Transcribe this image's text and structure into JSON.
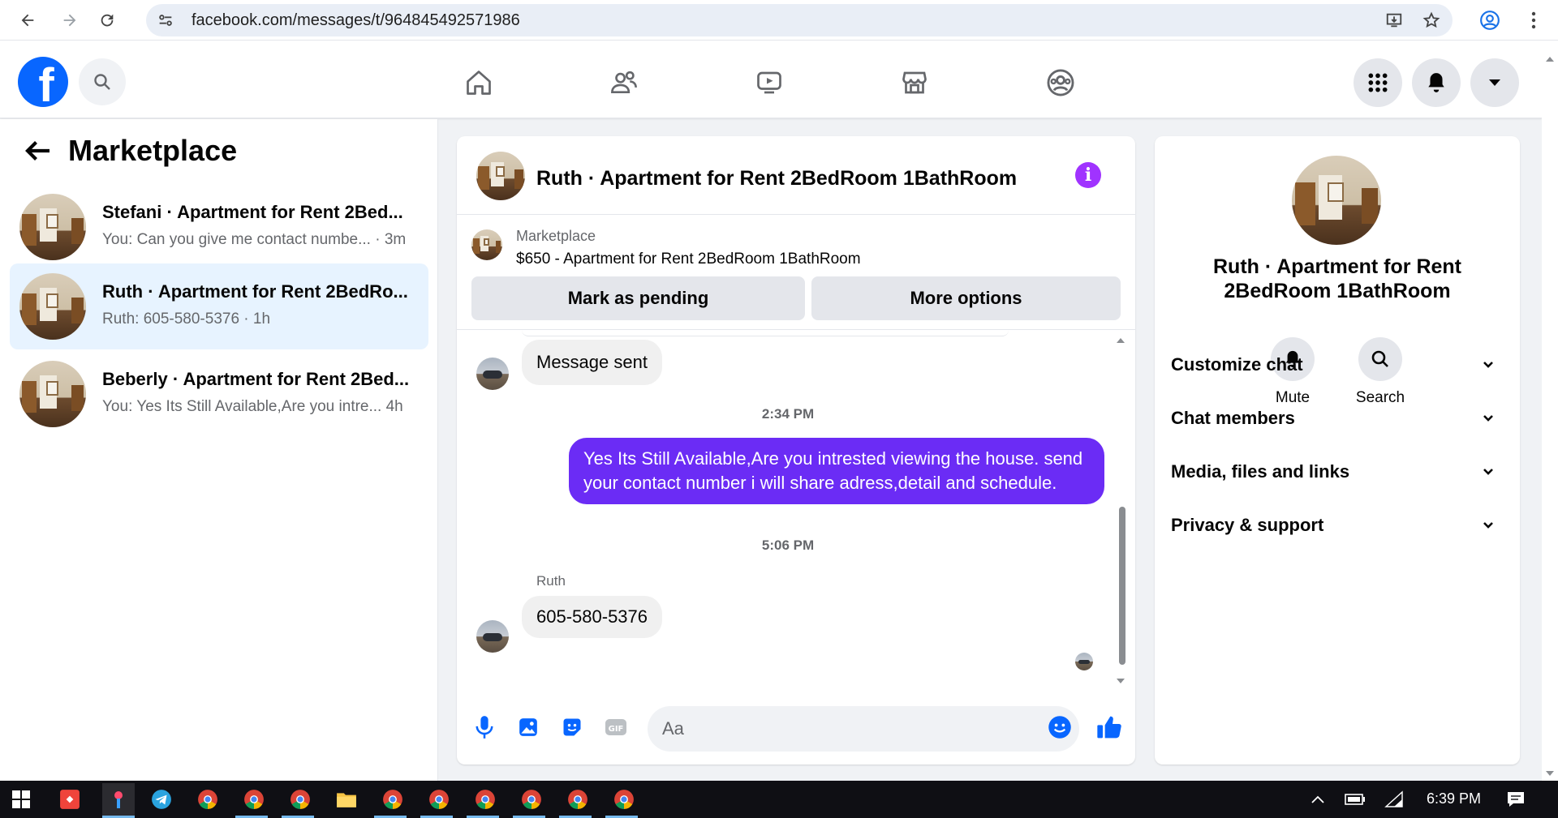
{
  "browser": {
    "url": "facebook.com/messages/t/964845492571986"
  },
  "header": {
    "logo_letter": "f"
  },
  "left_panel": {
    "title": "Marketplace",
    "conversations": [
      {
        "name": "Stefani · Apartment for Rent 2Bed...",
        "preview": "You: Can you give me contact numbe... · 3m",
        "active": false
      },
      {
        "name": "Ruth · Apartment for Rent 2BedRo...",
        "preview": "Ruth: 605-580-5376 · 1h",
        "active": true
      },
      {
        "name": "Beberly · Apartment for Rent 2Bed...",
        "preview": "You: Yes Its Still Available,Are you intre... 4h",
        "active": false
      }
    ]
  },
  "chat": {
    "title": "Ruth · Apartment for Rent 2BedRoom 1BathRoom",
    "marketplace_label": "Marketplace",
    "listing": "$650 - Apartment for Rent 2BedRoom 1BathRoom",
    "mark_pending_label": "Mark as pending",
    "more_options_label": "More options",
    "messages": {
      "sent_notice": "Message sent",
      "time1": "2:34 PM",
      "outgoing": "Yes Its Still Available,Are you intrested viewing the house. send your contact number i will share adress,detail and schedule.",
      "time2": "5:06 PM",
      "sender": "Ruth",
      "incoming": "605-580-5376"
    },
    "composer_placeholder": "Aa"
  },
  "right_panel": {
    "name": "Ruth · Apartment for Rent 2BedRoom 1BathRoom",
    "mute_label": "Mute",
    "search_label": "Search",
    "sections": [
      "Customize chat",
      "Chat members",
      "Media, files and links",
      "Privacy & support"
    ]
  },
  "taskbar": {
    "time": "6:39 PM"
  },
  "colors": {
    "brand": "#0866ff",
    "outgoing_bubble": "#6b2cf5",
    "active_row": "#e7f3ff",
    "info_icon": "#a033ff"
  }
}
